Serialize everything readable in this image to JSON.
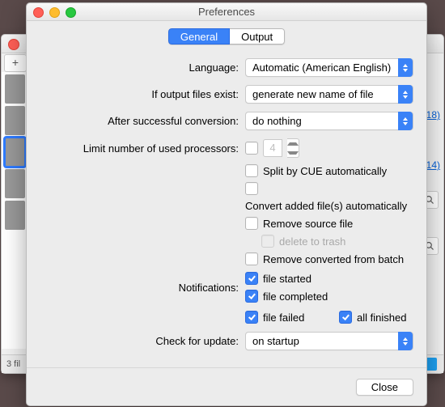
{
  "window": {
    "title": "Preferences"
  },
  "tabs": {
    "general": "General",
    "output": "Output"
  },
  "labels": {
    "language": "Language:",
    "if_output": "If output files exist:",
    "after_conv": "After successful conversion:",
    "limit_proc": "Limit number of used processors:",
    "notifications": "Notifications:",
    "check_update": "Check for update:"
  },
  "selects": {
    "language": "Automatic (American English)",
    "if_output": "generate new name of file",
    "after_conv": "do nothing",
    "check_update": "on startup"
  },
  "processors": {
    "value": "4"
  },
  "checks": {
    "split_cue": "Split by CUE automatically",
    "convert_auto": "Convert added file(s) automatically",
    "remove_src": "Remove source file",
    "delete_trash": "delete to trash",
    "remove_batch": "Remove converted from batch"
  },
  "notifications": {
    "file_started": "file started",
    "file_completed": "file completed",
    "file_failed": "file failed",
    "all_finished": "all finished"
  },
  "footer": {
    "close": "Close"
  },
  "background": {
    "add": "+",
    "status": "3 fil",
    "link1": "18)",
    "link2": "14)"
  }
}
